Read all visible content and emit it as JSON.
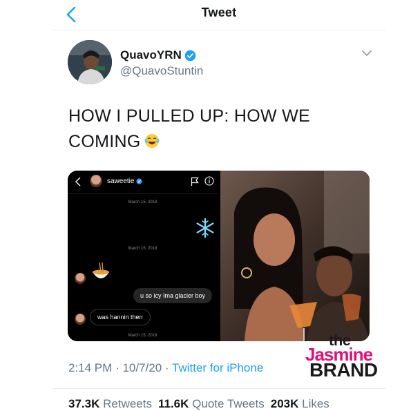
{
  "header": {
    "title": "Tweet"
  },
  "tweet": {
    "display_name": "QuavoYRN",
    "handle": "@QuavoStuntin",
    "text": "HOW I PULLED UP:  HOW WE COMING",
    "emoji": "face-with-tears-of-joy",
    "time": "2:14 PM",
    "date": "10/7/20",
    "source": "Twitter for iPhone",
    "separator": "·"
  },
  "dm": {
    "username": "saweetie",
    "date1": "March 15, 2018",
    "date2": "March 15, 2018",
    "date3": "March 15, 2018",
    "msg_out": "u so icy Ima glacier boy",
    "msg_in": "was hannin then"
  },
  "stats": {
    "retweets_count": "37.3K",
    "retweets_label": "Retweets",
    "quotes_count": "11.6K",
    "quotes_label": "Quote Tweets",
    "likes_count": "203K",
    "likes_label": "Likes"
  },
  "watermark": {
    "line1": "the",
    "line2": "Jasmine",
    "line3": "BRAND"
  },
  "colors": {
    "accent": "#1da1f2",
    "text": "#14171a",
    "muted": "#657786",
    "watermark_pink": "#e0127a"
  }
}
